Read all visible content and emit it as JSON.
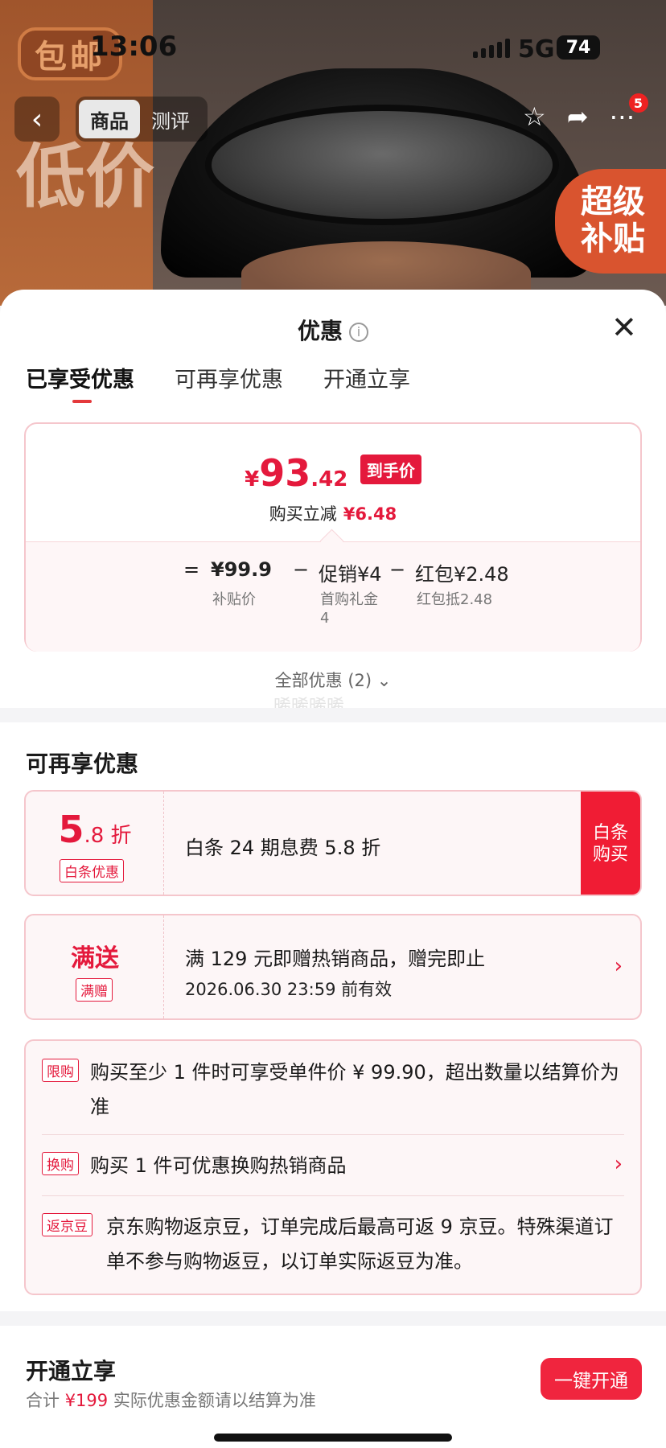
{
  "status_bar": {
    "time": "13:06",
    "network": "5G",
    "battery": "74"
  },
  "backdrop": {
    "badge_baoyou": "包邮",
    "side_text": "低价",
    "subsidy_line1": "超级",
    "subsidy_line2": "补贴"
  },
  "nav": {
    "tab_product": "商品",
    "tab_review": "测评",
    "more_badge": "5"
  },
  "sheet": {
    "title": "优惠",
    "tabs": [
      "已享受优惠",
      "可再享优惠",
      "开通立享"
    ],
    "price": {
      "currency": "¥",
      "int": "93",
      "dec": ".42",
      "tag": "到手价"
    },
    "reduce": {
      "label": "购买立减",
      "amount": "¥6.48"
    },
    "formula": {
      "eq": "=",
      "base": "¥99.9",
      "base_note": "补贴价",
      "promo": "促销¥4",
      "promo_note": "首购礼金\n4",
      "red": "红包¥2.48",
      "red_note": "红包抵2.48",
      "minus": "−"
    },
    "all_offers": "全部优惠 (2) ⌄",
    "watermark": "晞晞晞晞"
  },
  "more_offers": {
    "title": "可再享优惠",
    "baitiao": {
      "num": "5",
      "unit": ".8 折",
      "tag": "白条优惠",
      "text": "白条 24 期息费 5.8 折",
      "button": "白条\n购买"
    },
    "gift": {
      "title": "满送",
      "tag": "满赠",
      "line1": "满 129 元即赠热销商品，赠完即止",
      "line2": "2026.06.30 23:59 前有效"
    },
    "promos": [
      {
        "tag": "限购",
        "text": "购买至少 1 件时可享受单件价 ¥ 99.90，超出数量以结算价为准"
      },
      {
        "tag": "换购",
        "text": "购买 1 件可优惠换购热销商品"
      },
      {
        "tag": "返京豆",
        "text": "京东购物返京豆，订单完成后最高可返 9 京豆。特殊渠道订单不参与购物返豆，以订单实际返豆为准。"
      }
    ]
  },
  "open": {
    "title": "开通立享",
    "sub_prefix": "合计",
    "sub_amount": "¥199",
    "sub_suffix": "实际优惠金额请以结算为准",
    "button": "一键开通"
  },
  "colors": {
    "accent": "#e4193c",
    "border": "#f5c6cc"
  }
}
